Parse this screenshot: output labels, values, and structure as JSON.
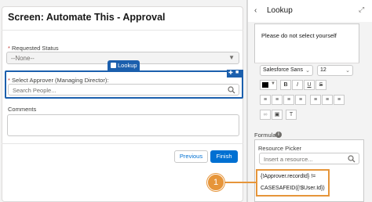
{
  "screen": {
    "title": "Screen: Automate This - Approval",
    "requested_status": {
      "required_mark": "*",
      "label": "Requested Status",
      "value": "--None--"
    },
    "lookup_tab_label": "Lookup",
    "select_approver": {
      "required_mark": "*",
      "label": "Select Approver (Managing Director):",
      "placeholder": "Search People..."
    },
    "comments_label": "Comments",
    "buttons": {
      "previous": "Previous",
      "finish": "Finish"
    }
  },
  "panel": {
    "title": "Lookup",
    "editor_text": "Please do not select yourself",
    "toolbar": {
      "font_family": "Salesforce Sans",
      "font_size": "12",
      "bold": "B",
      "italic": "I",
      "underline": "U",
      "strike": "S",
      "clear_format": "T"
    },
    "formula_label": "Formula",
    "resource_picker": {
      "label": "Resource Picker",
      "placeholder": "Insert a resource..."
    },
    "formula_lines": [
      "{!Approver.recordId} !=",
      "CASESAFEID({!$User.Id})"
    ]
  },
  "callout": {
    "number": "1"
  },
  "colors": {
    "selection_blue": "#1b5fad",
    "brand_button": "#0070d2",
    "callout_orange": "#e6953a"
  }
}
